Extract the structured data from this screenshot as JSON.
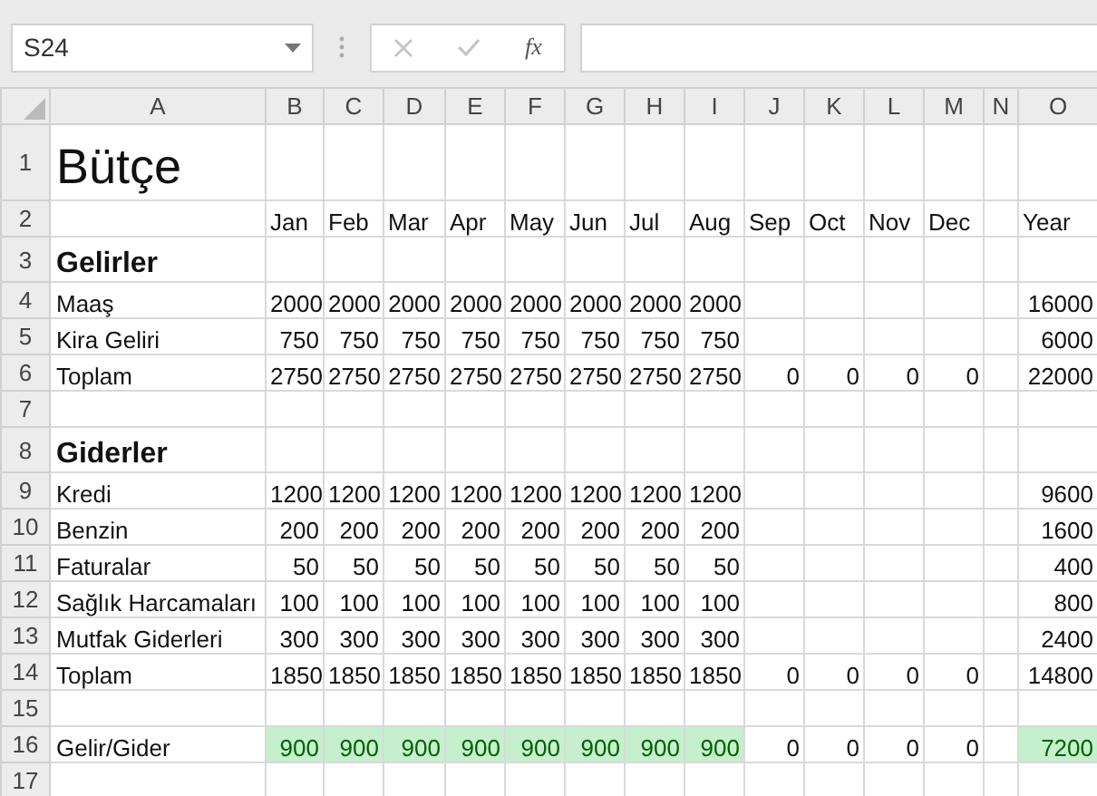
{
  "name_box": {
    "value": "S24"
  },
  "formula_bar": {
    "function_label": "fx"
  },
  "columns": [
    "A",
    "B",
    "C",
    "D",
    "E",
    "F",
    "G",
    "H",
    "I",
    "J",
    "K",
    "L",
    "M",
    "N",
    "O"
  ],
  "rows": [
    {
      "number": "1",
      "kind": "title",
      "label": "Bütçe",
      "cells": []
    },
    {
      "number": "2",
      "kind": "header",
      "cells": [
        "Jan",
        "Feb",
        "Mar",
        "Apr",
        "May",
        "Jun",
        "Jul",
        "Aug",
        "Sep",
        "Oct",
        "Nov",
        "Dec",
        null,
        "Year"
      ]
    },
    {
      "number": "3",
      "kind": "section",
      "label": "Gelirler",
      "cells": []
    },
    {
      "number": "4",
      "kind": "data",
      "label": "Maaş",
      "cells": [
        "2000",
        "2000",
        "2000",
        "2000",
        "2000",
        "2000",
        "2000",
        "2000",
        null,
        null,
        null,
        null,
        null,
        "16000"
      ]
    },
    {
      "number": "5",
      "kind": "data",
      "label": "Kira Geliri",
      "cells": [
        "750",
        "750",
        "750",
        "750",
        "750",
        "750",
        "750",
        "750",
        null,
        null,
        null,
        null,
        null,
        "6000"
      ]
    },
    {
      "number": "6",
      "kind": "total",
      "label": "Toplam",
      "cells": [
        "2750",
        "2750",
        "2750",
        "2750",
        "2750",
        "2750",
        "2750",
        "2750",
        "0",
        "0",
        "0",
        "0",
        null,
        "22000"
      ]
    },
    {
      "number": "7",
      "kind": "blank",
      "cells": []
    },
    {
      "number": "8",
      "kind": "section",
      "label": "Giderler",
      "cells": []
    },
    {
      "number": "9",
      "kind": "data",
      "label": "Kredi",
      "cells": [
        "1200",
        "1200",
        "1200",
        "1200",
        "1200",
        "1200",
        "1200",
        "1200",
        null,
        null,
        null,
        null,
        null,
        "9600"
      ]
    },
    {
      "number": "10",
      "kind": "data",
      "label": "Benzin",
      "cells": [
        "200",
        "200",
        "200",
        "200",
        "200",
        "200",
        "200",
        "200",
        null,
        null,
        null,
        null,
        null,
        "1600"
      ]
    },
    {
      "number": "11",
      "kind": "data",
      "label": "Faturalar",
      "cells": [
        "50",
        "50",
        "50",
        "50",
        "50",
        "50",
        "50",
        "50",
        null,
        null,
        null,
        null,
        null,
        "400"
      ]
    },
    {
      "number": "12",
      "kind": "data",
      "label": "Sağlık Harcamaları",
      "cells": [
        "100",
        "100",
        "100",
        "100",
        "100",
        "100",
        "100",
        "100",
        null,
        null,
        null,
        null,
        null,
        "800"
      ]
    },
    {
      "number": "13",
      "kind": "data",
      "label": "Mutfak Giderleri",
      "cells": [
        "300",
        "300",
        "300",
        "300",
        "300",
        "300",
        "300",
        "300",
        null,
        null,
        null,
        null,
        null,
        "2400"
      ]
    },
    {
      "number": "14",
      "kind": "total",
      "label": "Toplam",
      "cells": [
        "1850",
        "1850",
        "1850",
        "1850",
        "1850",
        "1850",
        "1850",
        "1850",
        "0",
        "0",
        "0",
        "0",
        null,
        "14800"
      ]
    },
    {
      "number": "15",
      "kind": "blank",
      "cells": []
    },
    {
      "number": "16",
      "kind": "data",
      "label": "Gelir/Gider",
      "cells": [
        "900",
        "900",
        "900",
        "900",
        "900",
        "900",
        "900",
        "900",
        "0",
        "0",
        "0",
        "0",
        null,
        "7200"
      ],
      "highlighted": [
        true,
        true,
        true,
        true,
        true,
        true,
        true,
        true,
        false,
        false,
        false,
        false,
        false,
        true
      ]
    },
    {
      "number": "17",
      "kind": "blank",
      "cells": []
    }
  ]
}
